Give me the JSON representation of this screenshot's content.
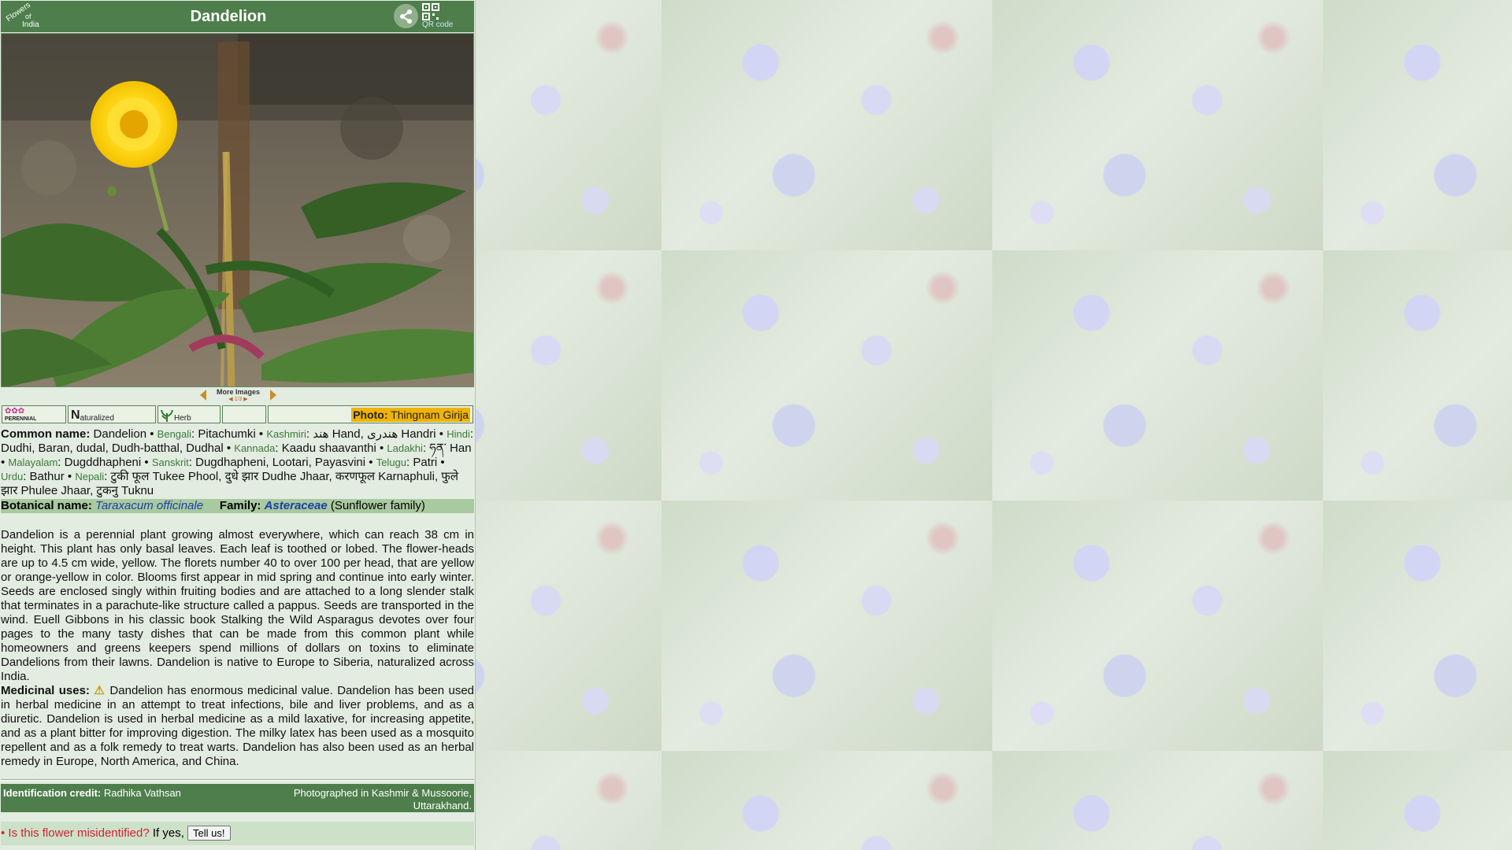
{
  "header": {
    "logo_line1": "Flowers",
    "logo_line2": "of",
    "logo_line3": "India",
    "title": "Dandelion",
    "qr_label": "QR code"
  },
  "gallery": {
    "more_images": "More Images",
    "more_images_sub": "◀ 1/3 ▶"
  },
  "info_row": {
    "perennial": "PERENNIAL",
    "naturalized_letter": "N",
    "naturalized": "aturalized",
    "herb": "Herb",
    "photo_label": "Photo:",
    "photo_credit": "Thingnam Girija"
  },
  "names": {
    "common_label": "Common name:",
    "common": "Dandelion",
    "entries": [
      {
        "lang": "Bengali",
        "value": "Pitachumki"
      },
      {
        "lang": "Kashmiri",
        "value": "هند Hand, هندری Handri"
      },
      {
        "lang": "Hindi",
        "value": "Dudhi, Baran, dudal, Dudh-batthal, Dudhal"
      },
      {
        "lang": "Kannada",
        "value": "Kaadu shaavanthi"
      },
      {
        "lang": "Ladakhi",
        "value": "ཧན་ Han"
      },
      {
        "lang": "Malayalam",
        "value": "Dugddhapheni"
      },
      {
        "lang": "Sanskrit",
        "value": "Dugdhapheni, Lootari, Payasvini"
      },
      {
        "lang": "Telugu",
        "value": "Patri"
      },
      {
        "lang": "Urdu",
        "value": "Bathur"
      },
      {
        "lang": "Nepali",
        "value": "टुकी फूल Tukee Phool, दुधे झार Dudhe Jhaar, करणफूल Karnaphuli, फुले झार Phulee Jhaar, टुकनु Tuknu"
      }
    ],
    "botanical_label": "Botanical name:",
    "botanical": "Taraxacum officinale",
    "family_label": "Family:",
    "family": "Asteraceae",
    "family_common": "(Sunflower family)"
  },
  "description": "Dandelion is a perennial plant growing almost everywhere, which can reach 38 cm in height. This plant has only basal leaves. Each leaf is toothed or lobed. The flower-heads are up to 4.5 cm wide, yellow. The florets number 40 to over 100 per head, that are yellow or orange-yellow in color. Blooms first appear in mid spring and continue into early winter. Seeds are enclosed singly within fruiting bodies and are attached to a long slender stalk that terminates in a parachute-like structure called a pappus. Seeds are transported in the wind. Euell Gibbons in his classic book Stalking the Wild Asparagus devotes over four pages to the many tasty dishes that can be made from this common plant while homeowners and greens keepers spend millions of dollars on toxins to eliminate Dandelions from their lawns. Dandelion is native to Europe to Siberia, naturalized across India.",
  "medicinal": {
    "label": "Medicinal uses:",
    "text": "Dandelion has enormous medicinal value. Dandelion has been used in herbal medicine in an attempt to treat infections, bile and liver problems, and as a diuretic. Dandelion is used in herbal medicine as a mild laxative, for increasing appetite, and as a plant bitter for improving digestion. The milky latex has been used as a mosquito repellent and as a folk remedy to treat warts. Dandelion has also been used as an herbal remedy in Europe, North America, and China."
  },
  "credit": {
    "label": "Identification credit:",
    "name": "Radhika Vathsan",
    "photographed": "Photographed in Kashmir & Mussoorie, Uttarakhand."
  },
  "misidentified": {
    "question": "• Is this flower misidentified?",
    "if_yes": "If yes,",
    "button": "Tell us!"
  }
}
